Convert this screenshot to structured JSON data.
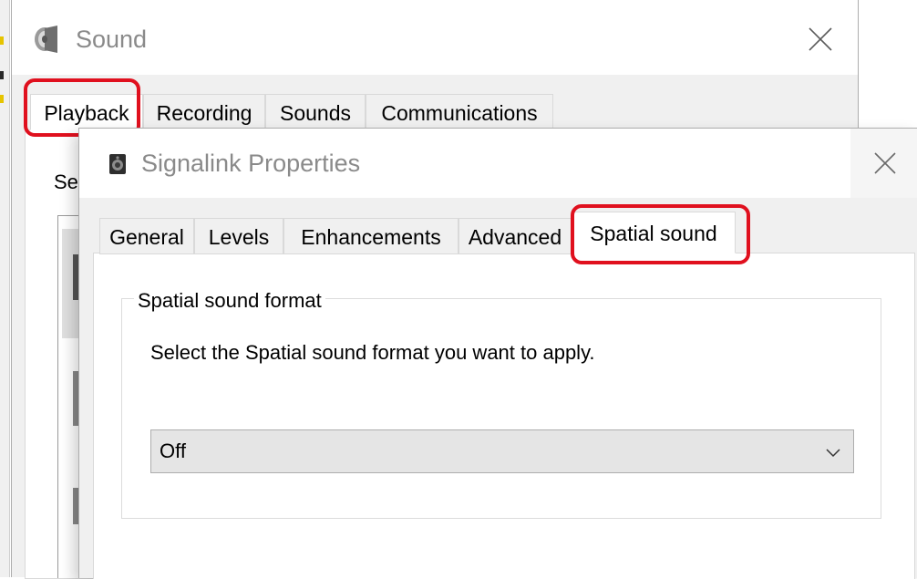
{
  "sound_window": {
    "title": "Sound",
    "tabs": [
      {
        "label": "Playback",
        "active": true
      },
      {
        "label": "Recording",
        "active": false
      },
      {
        "label": "Sounds",
        "active": false
      },
      {
        "label": "Communications",
        "active": false
      }
    ],
    "partial_text": "Se"
  },
  "properties_dialog": {
    "title": "Signalink Properties",
    "tabs": [
      {
        "label": "General",
        "active": false
      },
      {
        "label": "Levels",
        "active": false
      },
      {
        "label": "Enhancements",
        "active": false
      },
      {
        "label": "Advanced",
        "active": false
      },
      {
        "label": "Spatial sound",
        "active": true
      }
    ],
    "group": {
      "legend": "Spatial sound format",
      "description": "Select the Spatial sound format you want to apply.",
      "format_select": {
        "value": "Off"
      }
    }
  },
  "highlights": {
    "color": "#e0101e",
    "targets": [
      "Playback",
      "Spatial sound"
    ]
  },
  "icons": {
    "sound_window": "speaker-icon",
    "properties_dialog": "speaker-device-icon",
    "close": "close-icon",
    "dropdown": "chevron-down-icon"
  }
}
